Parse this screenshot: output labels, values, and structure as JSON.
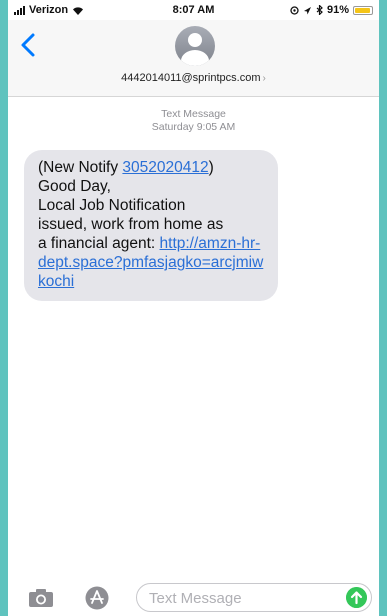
{
  "status": {
    "carrier": "Verizon",
    "time": "8:07 AM",
    "battery": "91%",
    "battery_level": 0.91
  },
  "header": {
    "contact": "4442014011@sprintpcs.com",
    "contact_chevron": "›"
  },
  "thread": {
    "service": "Text Message",
    "timestamp": "Saturday 9:05 AM"
  },
  "message": {
    "line1_prefix": "(New Notify ",
    "line1_number": "3052020412",
    "line1_suffix": ")",
    "line2": "Good Day,",
    "line3": "Local Job Notification",
    "line4": "issued, work from home as",
    "line5_prefix": "a financial agent: ",
    "link": "http://amzn-hr-dept.space?pmfasjagko=arcjmiwkochi"
  },
  "composer": {
    "placeholder": "Text Message"
  },
  "colors": {
    "frame": "#5fc3be",
    "link": "#2a6fd6",
    "bubble": "#e5e5ea",
    "send": "#34c759",
    "ios_blue": "#007aff"
  },
  "icons": [
    "signal-icon",
    "wifi-icon",
    "location-icon",
    "alarm-icon",
    "bluetooth-icon",
    "battery-icon",
    "back-chevron-icon",
    "avatar-icon",
    "camera-icon",
    "app-store-icon",
    "send-arrow-icon"
  ]
}
